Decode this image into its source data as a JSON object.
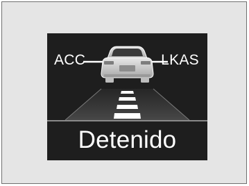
{
  "indicator": {
    "acc_label": "ACC",
    "lkas_label": "LKAS",
    "status_text": "Detenido"
  },
  "icons": [
    "car-rear-icon",
    "lane-marks-icon"
  ],
  "colors": {
    "panel": "#e5e5e5",
    "screen": "#1e1e1e",
    "text": "#ffffff",
    "car_body": "#c8c8c8"
  }
}
